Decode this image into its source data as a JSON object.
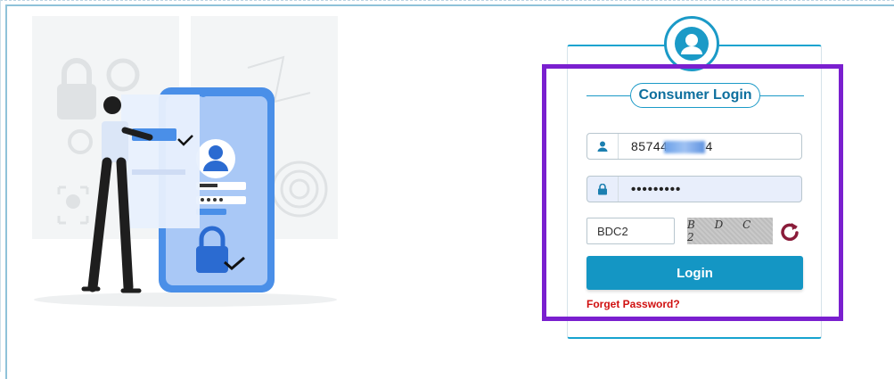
{
  "login": {
    "title": "Consumer Login",
    "username_value": "85744",
    "username_suffix": "4",
    "password_value": "•••••••••",
    "captcha_input_value": "BDC2",
    "captcha_text": "B D C 2",
    "login_label": "Login",
    "forgot_label": "Forget Password?"
  },
  "colors": {
    "accent": "#1496c4",
    "highlight": "#7a1fcf",
    "link": "#d01010"
  },
  "icons": [
    "user-avatar-icon",
    "user-icon",
    "lock-icon",
    "refresh-icon"
  ]
}
